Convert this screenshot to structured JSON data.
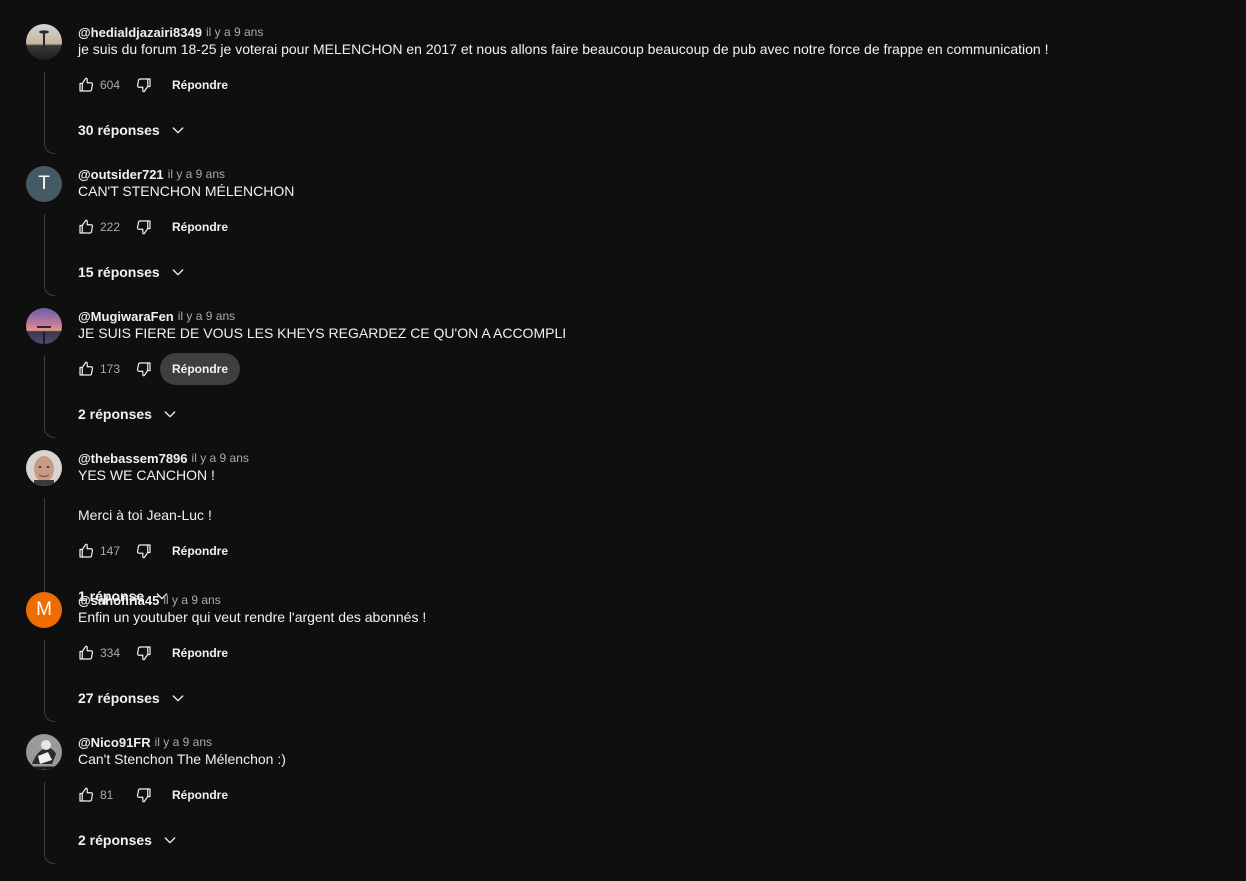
{
  "reply_label": "Répondre",
  "comments": [
    {
      "author": "@hedialdjazairi8349",
      "time": "il y a 9 ans",
      "lines": [
        "je suis du forum 18-25 je voterai pour MELENCHON en 2017 et nous allons faire beaucoup beaucoup de pub avec notre force de frappe en communication !"
      ],
      "likes": "604",
      "replies": "30 réponses",
      "avatar": {
        "type": "image",
        "icon": "landscape-photo-avatar"
      }
    },
    {
      "author": "@outsider721",
      "time": "il y a 9 ans",
      "lines": [
        "CAN'T STENCHON MÉLENCHON"
      ],
      "likes": "222",
      "replies": "15 réponses",
      "avatar": {
        "type": "letter",
        "letter": "T",
        "color": "#455a64"
      }
    },
    {
      "author": "@MugiwaraFen",
      "time": "il y a 9 ans",
      "lines": [
        "JE SUIS FIERE DE VOUS LES KHEYS REGARDEZ CE QU'ON A ACCOMPLI"
      ],
      "likes": "173",
      "replies": "2 réponses",
      "avatar": {
        "type": "image",
        "icon": "sunset-photo-avatar"
      }
    },
    {
      "author": "@thebassem7896",
      "time": "il y a 9 ans",
      "lines": [
        "YES WE CANCHON !",
        "",
        "Merci à toi Jean-Luc !"
      ],
      "likes": "147",
      "replies": "1 réponse",
      "avatar": {
        "type": "image",
        "icon": "face-photo-avatar"
      }
    },
    {
      "author": "@sahofiria45",
      "time": "il y a 9 ans",
      "lines": [
        "Enfin un youtuber qui veut rendre l'argent des abonnés !"
      ],
      "likes": "334",
      "replies": "27 réponses",
      "avatar": {
        "type": "letter",
        "letter": "M",
        "color": "#ef6c00"
      }
    },
    {
      "author": "@Nico91FR",
      "time": "il y a 9 ans",
      "lines": [
        "Can't Stenchon The Mélenchon :)"
      ],
      "likes": "81",
      "replies": "2 réponses",
      "avatar": {
        "type": "image",
        "icon": "bw-illustration-avatar"
      }
    }
  ]
}
